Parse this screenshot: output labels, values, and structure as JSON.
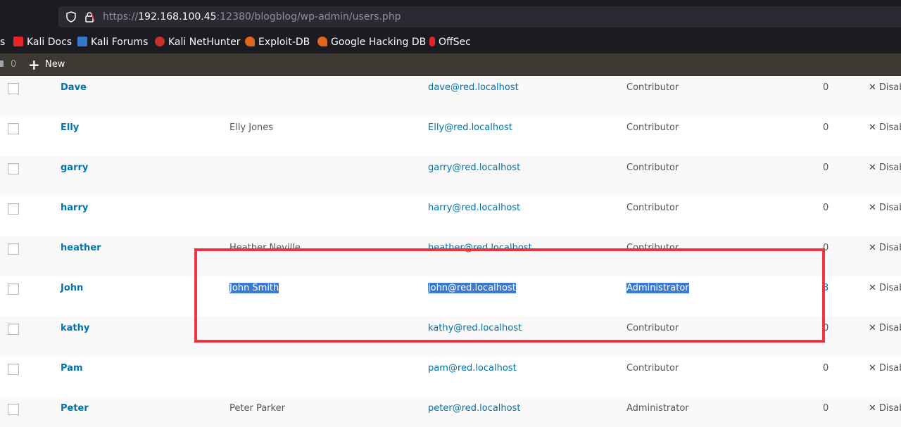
{
  "browser": {
    "url_prefix": "https://",
    "url_host": "192.168.100.45",
    "url_path": ":12380/blogblog/wp-admin/users.php"
  },
  "bookmarks": [
    {
      "label": "s",
      "icon": "none"
    },
    {
      "label": "Kali Docs",
      "icon": "kali-docs-icon",
      "color": "#e8232a"
    },
    {
      "label": "Kali Forums",
      "icon": "kali-forums-icon",
      "color": "#3577cf"
    },
    {
      "label": "Kali NetHunter",
      "icon": "kali-nethunter-icon",
      "color": "#c9302c"
    },
    {
      "label": "Exploit-DB",
      "icon": "exploit-db-icon",
      "color": "#e0661b"
    },
    {
      "label": "Google Hacking DB",
      "icon": "ghdb-icon",
      "color": "#e0661b"
    },
    {
      "label": "OffSec",
      "icon": "offsec-icon",
      "color": "#e8232a"
    }
  ],
  "admin_bar": {
    "comments_count": "0",
    "new_label": "New"
  },
  "users": [
    {
      "username": "Dave",
      "name": "",
      "email": "dave@red.localhost",
      "role": "Contributor",
      "posts": "0",
      "action": "Disab"
    },
    {
      "username": "Elly",
      "name": "Elly Jones",
      "email": "Elly@red.localhost",
      "role": "Contributor",
      "posts": "0",
      "action": "Disab"
    },
    {
      "username": "garry",
      "name": "",
      "email": "garry@red.localhost",
      "role": "Contributor",
      "posts": "0",
      "action": "Disab"
    },
    {
      "username": "harry",
      "name": "",
      "email": "harry@red.localhost",
      "role": "Contributor",
      "posts": "0",
      "action": "Disab"
    },
    {
      "username": "heather",
      "name": "Heather Neville",
      "email": "heather@red.localhost",
      "role": "Contributor",
      "posts": "0",
      "action": "Disab"
    },
    {
      "username": "John",
      "name": "John Smith",
      "email": "john@red.localhost",
      "role": "Administrator",
      "posts": "3",
      "action": "Disab"
    },
    {
      "username": "kathy",
      "name": "",
      "email": "kathy@red.localhost",
      "role": "Contributor",
      "posts": "0",
      "action": "Disab"
    },
    {
      "username": "Pam",
      "name": "",
      "email": "pam@red.localhost",
      "role": "Contributor",
      "posts": "0",
      "action": "Disab"
    },
    {
      "username": "Peter",
      "name": "Peter Parker",
      "email": "peter@red.localhost",
      "role": "Administrator",
      "posts": "0",
      "action": "Disab"
    }
  ],
  "colors": {
    "link": "#0073aa",
    "selection": "#3a7ad0",
    "highlight_box": "#ee3540",
    "admin_bar": "#3c3832"
  }
}
